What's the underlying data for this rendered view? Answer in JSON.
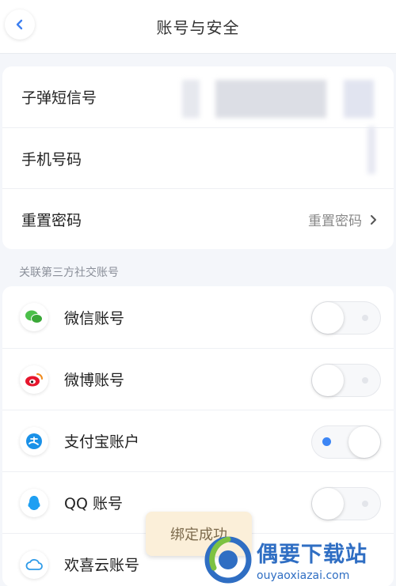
{
  "header": {
    "title": "账号与安全"
  },
  "account": {
    "bullet_id_label": "子弹短信号",
    "phone_label": "手机号码",
    "reset_label": "重置密码",
    "reset_value": "重置密码"
  },
  "social": {
    "section_title": "关联第三方社交账号",
    "items": [
      {
        "label": "微信账号",
        "icon": "wechat-icon",
        "enabled": false
      },
      {
        "label": "微博账号",
        "icon": "weibo-icon",
        "enabled": false
      },
      {
        "label": "支付宝账户",
        "icon": "alipay-icon",
        "enabled": true
      },
      {
        "label": "QQ 账号",
        "icon": "qq-icon",
        "enabled": false
      },
      {
        "label": "欢喜云账号",
        "icon": "cloud-icon",
        "enabled": false
      }
    ]
  },
  "toast": {
    "message": "绑定成功"
  },
  "watermark": {
    "title": "偶要下载站",
    "url": "ouyaoxiazai.com"
  },
  "colors": {
    "toggle_on": "#3d86f5",
    "toast_bg": "#fbefd9",
    "watermark": "#2f6ec3"
  }
}
